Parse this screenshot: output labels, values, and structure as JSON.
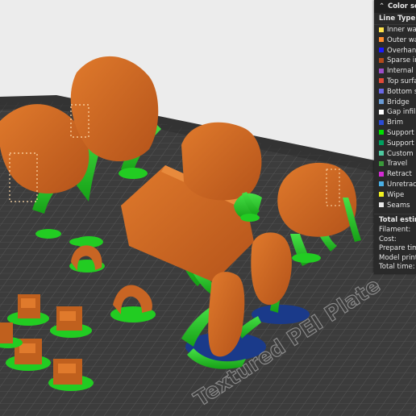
{
  "panel": {
    "title": "Color sc",
    "section": "Line Type",
    "line_types": [
      {
        "label": "Inner wall",
        "color": "#ffe24a"
      },
      {
        "label": "Outer wall",
        "color": "#ff8c2e"
      },
      {
        "label": "Overhang",
        "color": "#1a1aff"
      },
      {
        "label": "Sparse inf",
        "color": "#b24a1c"
      },
      {
        "label": "Internal s",
        "color": "#9b4fc9"
      },
      {
        "label": "Top surfac",
        "color": "#e04a38"
      },
      {
        "label": "Bottom su",
        "color": "#6a68e6"
      },
      {
        "label": "Bridge",
        "color": "#6a9bd6"
      },
      {
        "label": "Gap infill",
        "color": "#ffffff"
      },
      {
        "label": "Brim",
        "color": "#2a4bd6"
      },
      {
        "label": "Support",
        "color": "#00e000"
      },
      {
        "label": "Support in",
        "color": "#00a060"
      },
      {
        "label": "Custom",
        "color": "#4ec9a0"
      },
      {
        "label": "Travel",
        "color": "#3a9a3a"
      },
      {
        "label": "Retract",
        "color": "#d42ad4"
      },
      {
        "label": "Unretract",
        "color": "#4ab0e6"
      },
      {
        "label": "Wipe",
        "color": "#f0f020"
      },
      {
        "label": "Seams",
        "color": "#e8e8e8"
      }
    ],
    "estimate_title": "Total estima",
    "stats": [
      "Filament:",
      "Cost:",
      "Prepare time",
      "Model printin",
      "Total time:"
    ]
  },
  "plate": {
    "label": "Textured PEI Plate"
  },
  "colors": {
    "support": "#22cc22",
    "model": "#d2691e",
    "plate": "#3a3a3a",
    "brim": "#1a3a8a",
    "background": "#ececec"
  }
}
